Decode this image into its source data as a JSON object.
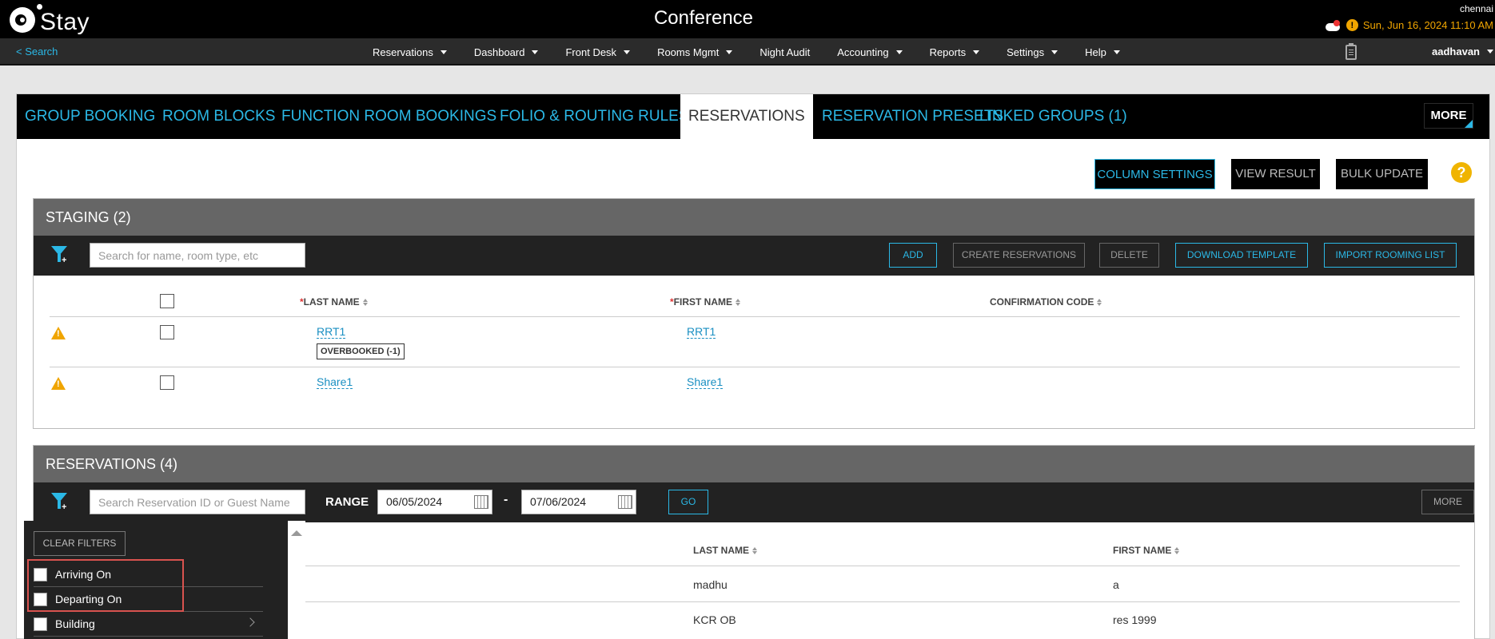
{
  "app": {
    "logo_text": "Stay",
    "title": "Conference",
    "property": "chennai",
    "datetime": "Sun, Jun 16, 2024 11:10 AM",
    "user": "aadhavan"
  },
  "nav": {
    "back_search": "< Search",
    "items": [
      {
        "label": "Reservations",
        "dropdown": true
      },
      {
        "label": "Dashboard",
        "dropdown": true
      },
      {
        "label": "Front Desk",
        "dropdown": true
      },
      {
        "label": "Rooms Mgmt",
        "dropdown": true
      },
      {
        "label": "Night Audit",
        "dropdown": false
      },
      {
        "label": "Accounting",
        "dropdown": true
      },
      {
        "label": "Reports",
        "dropdown": true
      },
      {
        "label": "Settings",
        "dropdown": true
      },
      {
        "label": "Help",
        "dropdown": true
      }
    ]
  },
  "tabs": [
    "GROUP BOOKING",
    "ROOM BLOCKS",
    "FUNCTION ROOM BOOKINGS",
    "FOLIO & ROUTING RULES",
    "RESERVATIONS",
    "RESERVATION PRESETS",
    "LINKED GROUPS (1)"
  ],
  "more_tab": "MORE",
  "actions": {
    "column_settings": "COLUMN SETTINGS",
    "view_result": "VIEW RESULT",
    "bulk_update": "BULK UPDATE",
    "help": "?"
  },
  "staging": {
    "title": "STAGING (2)",
    "search_placeholder": "Search for name, room type, etc",
    "buttons": {
      "add": "ADD",
      "create": "CREATE RESERVATIONS",
      "delete": "DELETE",
      "download": "DOWNLOAD TEMPLATE",
      "import": "IMPORT ROOMING LIST"
    },
    "columns": {
      "last_name": "LAST NAME",
      "first_name": "FIRST NAME",
      "confirmation": "CONFIRMATION CODE"
    },
    "rows": [
      {
        "last_name": "RRT1",
        "first_name": "RRT1",
        "badge": "OVERBOOKED (-1)"
      },
      {
        "last_name": "Share1",
        "first_name": "Share1"
      }
    ]
  },
  "reservations": {
    "title": "RESERVATIONS (4)",
    "search_placeholder": "Search Reservation ID or Guest Name",
    "range_label": "RANGE",
    "date_from": "06/05/2024",
    "date_sep": "-",
    "date_to": "07/06/2024",
    "go": "GO",
    "more": "MORE",
    "columns": {
      "last_name": "LAST NAME",
      "first_name": "FIRST NAME"
    },
    "rows": [
      {
        "last_name": "madhu",
        "first_name": "a"
      },
      {
        "last_name": "KCR OB",
        "first_name": "res 1999"
      }
    ]
  },
  "filter_panel": {
    "clear": "CLEAR FILTERS",
    "items": [
      "Arriving On",
      "Departing On",
      "Building"
    ]
  }
}
